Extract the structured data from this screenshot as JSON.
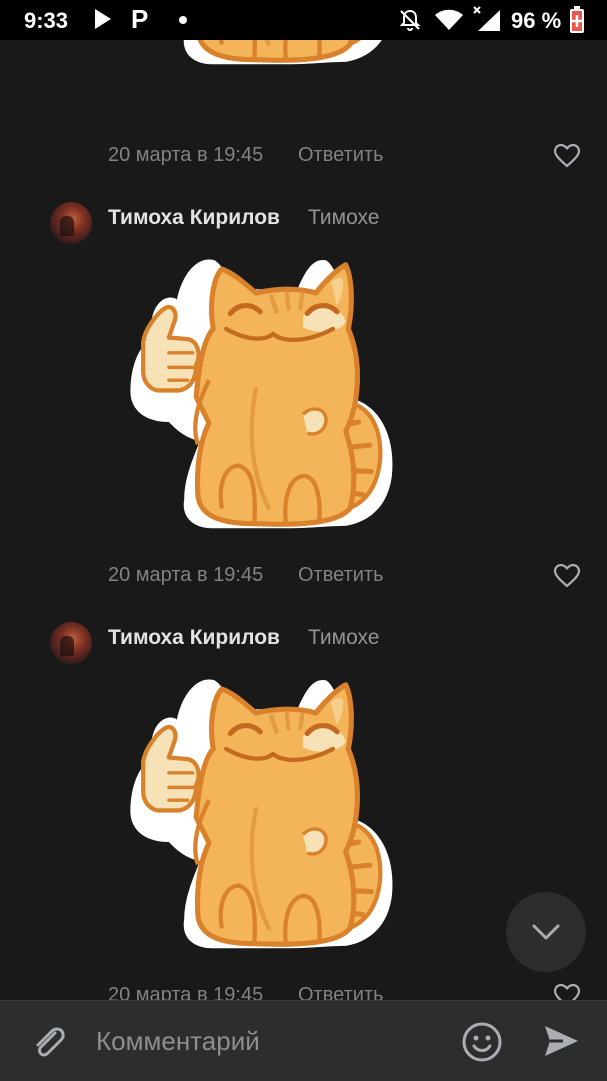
{
  "status_bar": {
    "time": "9:33",
    "app_icon_letter": "P",
    "battery": "96 %",
    "icons": [
      "play-icon",
      "p-app-icon",
      "notification-dot-icon",
      "mute-icon",
      "wifi-icon",
      "signal-icon",
      "battery-icon"
    ]
  },
  "messages": [
    {
      "author": "",
      "reply_to": "",
      "time": "20 марта в 19:45",
      "reply_label": "Ответить"
    },
    {
      "author": "Тимоха Кирилов",
      "reply_to": "Тимохе",
      "time": "20 марта в 19:45",
      "reply_label": "Ответить"
    },
    {
      "author": "Тимоха Кирилов",
      "reply_to": "Тимохе",
      "time": "20 марта в 19:45",
      "reply_label": "Ответить"
    }
  ],
  "composer": {
    "placeholder": "Комментарий"
  },
  "colors": {
    "background": "#19191a",
    "panel": "#2c2d2e",
    "text_primary": "#e1e3e6",
    "text_secondary": "#828282",
    "sticker_cat": "#f4b459",
    "sticker_outline": "#d9822b"
  }
}
